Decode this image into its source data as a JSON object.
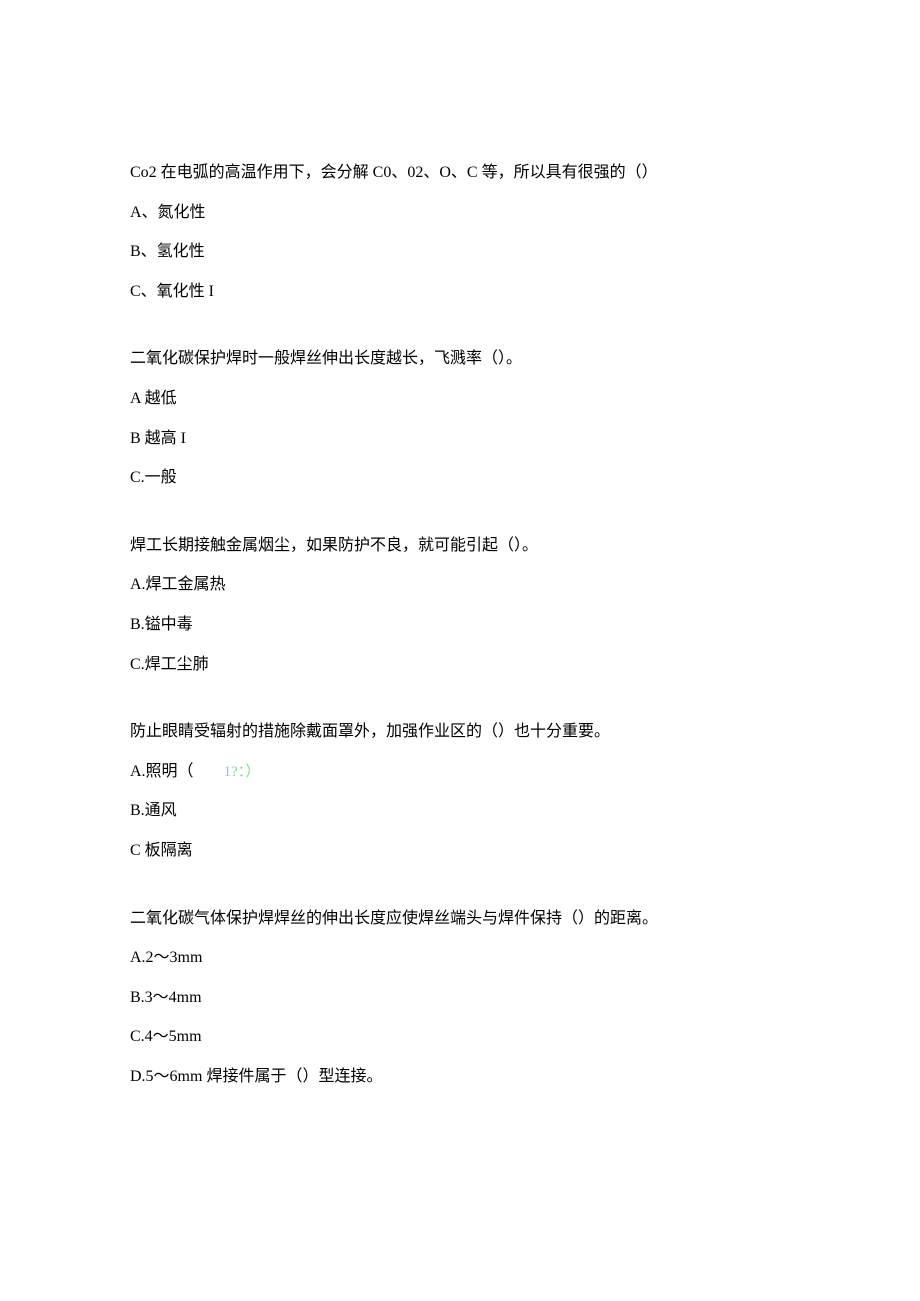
{
  "questions": [
    {
      "text": "Co2 在电弧的高温作用下，会分解 C0、02、O、C 等，所以具有很强的（）",
      "options": [
        "A、氮化性",
        "B、氢化性",
        "C、氧化性 I"
      ]
    },
    {
      "text": "二氧化碳保护焊时一般焊丝伸出长度越长，飞溅率（）。",
      "options": [
        "A 越低",
        "B 越高 I",
        "C.一般"
      ]
    },
    {
      "text": "焊工长期接触金属烟尘，如果防护不良，就可能引起（）。",
      "options": [
        "A.焊工金属热",
        "B.镒中毒",
        "C.焊工尘肺"
      ]
    },
    {
      "text": "防止眼睛受辐射的措施除戴面罩外，加强作业区的（）也十分重要。",
      "options_special": [
        {
          "label": "A.照明（",
          "hint": "1?：）"
        },
        {
          "label": "B.通风"
        },
        {
          "label": "C 板隔离"
        }
      ]
    },
    {
      "text": "二氧化碳气体保护焊焊丝的伸出长度应使焊丝端头与焊件保持（）的距离。",
      "options": [
        "A.2～3mm",
        "B.3～4mm",
        "C.4～5mm",
        "D.5～6mm 焊接件属于（）型连接。"
      ]
    }
  ]
}
